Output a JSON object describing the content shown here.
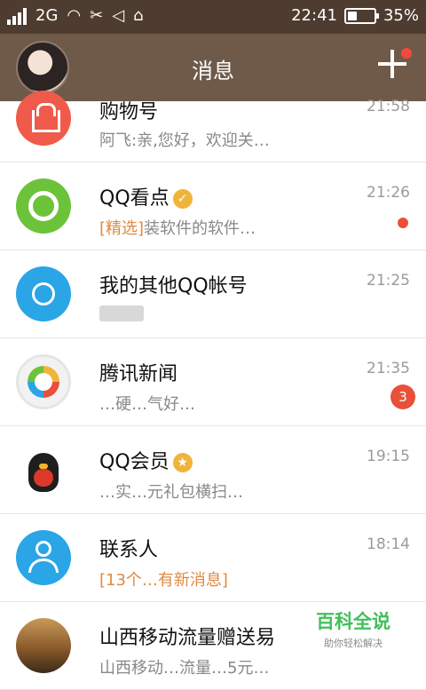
{
  "status_bar": {
    "network": "2G",
    "time": "22:41",
    "battery": "35%",
    "battery_level": 0.35
  },
  "header": {
    "title": "消息"
  },
  "conversations": [
    {
      "name": "购物号",
      "time": "21:58",
      "preview": "阿飞:亲,您好，欢迎关…",
      "avatar": "shopping-bag"
    },
    {
      "name": "QQ看点",
      "time": "21:26",
      "tag": "[精选]",
      "preview": "装软件的软件…",
      "avatar": "qq-read",
      "unread": true
    },
    {
      "name": "我的其他QQ帐号",
      "time": "21:25",
      "preview": "",
      "avatar": "blue-circle"
    },
    {
      "name": "腾讯新闻",
      "time": "21:35",
      "preview": "…硬…气好…",
      "avatar": "news-logo",
      "unread_count": "3"
    },
    {
      "name": "QQ会员",
      "time": "19:15",
      "preview": "…实…元礼包横扫…",
      "avatar": "qq-penguin"
    },
    {
      "name": "联系人",
      "time": "18:14",
      "tag": "[13个…有新消息]",
      "preview": "",
      "avatar": "contact"
    },
    {
      "name": "山西移动流量赠送易",
      "time": "",
      "preview": "山西移动…流量…5元…",
      "avatar": "autumn-photo"
    }
  ],
  "watermark": {
    "title": "百科全说",
    "subtitle": "助你轻松解决"
  }
}
